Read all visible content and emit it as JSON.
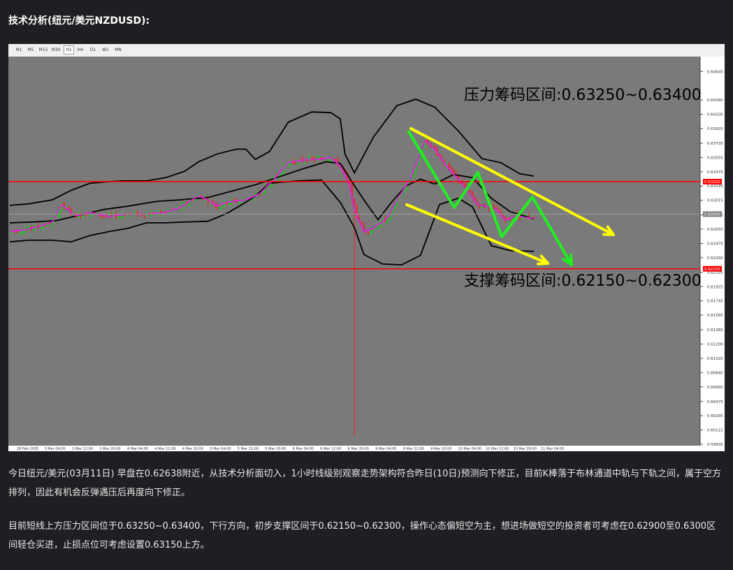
{
  "page_title": "技术分析(纽元/美元NZDUSD):",
  "toolbar": {
    "timeframes": [
      "M1",
      "M5",
      "M15",
      "M30",
      "H1",
      "H4",
      "D1",
      "W1",
      "MN"
    ],
    "active": "H1"
  },
  "colors": {
    "plot_bg": "#7a7a7a",
    "bull": "#00dd00",
    "bear": "#ff1a1a",
    "band": "#000000",
    "ma": "#e020e0",
    "sr_line": "#ff0000",
    "channel": "#ffff00",
    "path": "#22ee22"
  },
  "chart_data": {
    "type": "candlestick",
    "symbol": "NZDUSD",
    "timeframe": "H1",
    "ylim": [
      0.59935,
      0.6474
    ],
    "yticks": [
      "0.64640",
      "0.64280",
      "0.64100",
      "0.63920",
      "0.63735",
      "0.63555",
      "0.63375",
      "0.63195",
      "0.63015",
      "0.62830",
      "0.62650",
      "0.62470",
      "0.62290",
      "0.62105",
      "0.61925",
      "0.61745",
      "0.61565",
      "0.61380",
      "0.61200",
      "0.61020",
      "0.60840",
      "0.60660",
      "0.60475",
      "0.60295",
      "0.60115",
      "0.59935"
    ],
    "xticks": [
      "28 Feb 2025",
      "3 Mar 04:00",
      "3 Mar 12:00",
      "3 Mar 20:00",
      "4 Mar 04:00",
      "4 Mar 12:00",
      "4 Mar 20:00",
      "5 Mar 04:00",
      "5 Mar 12:00",
      "5 Mar 20:00",
      "6 Mar 04:00",
      "6 Mar 12:00",
      "6 Mar 20:00",
      "9 Mar 04:00",
      "9 Mar 12:00",
      "9 Mar 20:00",
      "10 Mar 04:00",
      "10 Mar 12:00",
      "10 Mar 20:00",
      "11 Mar 04:00"
    ],
    "price_labels": [
      {
        "value": 0.6325,
        "text": "0.63250",
        "color": "#ff0000"
      },
      {
        "value": 0.6284,
        "text": "0.62840",
        "color": "#808080"
      },
      {
        "value": 0.6215,
        "text": "0.62150",
        "color": "#ff0000"
      }
    ],
    "resistance_zone": {
      "label": "压力筹码区间:0.63250~0.63400",
      "line": 0.6325
    },
    "support_zone": {
      "label": "支撑筹码区间:0.62150~0.62300",
      "line": 0.6215
    },
    "spike_low": 0.6005,
    "upper_band": [
      [
        0,
        0.6295
      ],
      [
        8,
        0.6297
      ],
      [
        18,
        0.6302
      ],
      [
        26,
        0.6314
      ],
      [
        34,
        0.6323
      ],
      [
        42,
        0.6325
      ],
      [
        48,
        0.6326
      ],
      [
        58,
        0.6326
      ],
      [
        66,
        0.633
      ],
      [
        74,
        0.6338
      ],
      [
        80,
        0.635
      ],
      [
        88,
        0.636
      ],
      [
        96,
        0.6366
      ],
      [
        100,
        0.6366
      ],
      [
        104,
        0.6353
      ],
      [
        110,
        0.6363
      ],
      [
        118,
        0.64
      ],
      [
        128,
        0.6413
      ],
      [
        136,
        0.6412
      ],
      [
        140,
        0.6404
      ],
      [
        142,
        0.636
      ],
      [
        146,
        0.6336
      ],
      [
        154,
        0.6381
      ],
      [
        164,
        0.6421
      ],
      [
        172,
        0.6429
      ],
      [
        180,
        0.6419
      ],
      [
        190,
        0.6389
      ],
      [
        200,
        0.6354
      ],
      [
        208,
        0.6349
      ],
      [
        216,
        0.6335
      ],
      [
        222,
        0.6332
      ]
    ],
    "lower_band": [
      [
        0,
        0.6249
      ],
      [
        8,
        0.6251
      ],
      [
        18,
        0.6251
      ],
      [
        26,
        0.6249
      ],
      [
        34,
        0.6257
      ],
      [
        42,
        0.6262
      ],
      [
        50,
        0.6266
      ],
      [
        58,
        0.6273
      ],
      [
        66,
        0.6273
      ],
      [
        74,
        0.6274
      ],
      [
        84,
        0.6275
      ],
      [
        92,
        0.6285
      ],
      [
        100,
        0.6299
      ],
      [
        104,
        0.6307
      ],
      [
        110,
        0.6323
      ],
      [
        122,
        0.6326
      ],
      [
        132,
        0.6327
      ],
      [
        140,
        0.6299
      ],
      [
        146,
        0.6267
      ],
      [
        150,
        0.6233
      ],
      [
        158,
        0.6221
      ],
      [
        166,
        0.622
      ],
      [
        174,
        0.6232
      ],
      [
        182,
        0.6296
      ],
      [
        190,
        0.6304
      ],
      [
        196,
        0.6293
      ],
      [
        204,
        0.6244
      ],
      [
        212,
        0.6238
      ],
      [
        222,
        0.6237
      ]
    ],
    "mid_band": [
      [
        0,
        0.6273
      ],
      [
        10,
        0.6274
      ],
      [
        20,
        0.6276
      ],
      [
        30,
        0.6283
      ],
      [
        40,
        0.629
      ],
      [
        50,
        0.6294
      ],
      [
        62,
        0.63
      ],
      [
        72,
        0.6302
      ],
      [
        84,
        0.6305
      ],
      [
        94,
        0.6313
      ],
      [
        104,
        0.6321
      ],
      [
        114,
        0.6331
      ],
      [
        124,
        0.6341
      ],
      [
        134,
        0.635
      ],
      [
        140,
        0.6348
      ],
      [
        146,
        0.632
      ],
      [
        150,
        0.6302
      ],
      [
        156,
        0.6277
      ],
      [
        162,
        0.63
      ],
      [
        168,
        0.632
      ],
      [
        174,
        0.6328
      ],
      [
        180,
        0.6322
      ],
      [
        188,
        0.6334
      ],
      [
        196,
        0.633
      ],
      [
        204,
        0.6304
      ],
      [
        212,
        0.6287
      ],
      [
        222,
        0.6278
      ]
    ],
    "ma": [
      [
        0,
        0.6262
      ],
      [
        6,
        0.6264
      ],
      [
        12,
        0.6268
      ],
      [
        18,
        0.6274
      ],
      [
        22,
        0.6296
      ],
      [
        28,
        0.6282
      ],
      [
        34,
        0.6286
      ],
      [
        42,
        0.6281
      ],
      [
        50,
        0.6284
      ],
      [
        58,
        0.6284
      ],
      [
        66,
        0.6286
      ],
      [
        72,
        0.6292
      ],
      [
        76,
        0.63
      ],
      [
        80,
        0.6307
      ],
      [
        84,
        0.6302
      ],
      [
        88,
        0.6294
      ],
      [
        92,
        0.6299
      ],
      [
        100,
        0.6302
      ],
      [
        106,
        0.631
      ],
      [
        112,
        0.6328
      ],
      [
        118,
        0.6349
      ],
      [
        124,
        0.6352
      ],
      [
        130,
        0.6353
      ],
      [
        136,
        0.6355
      ],
      [
        140,
        0.6345
      ],
      [
        144,
        0.632
      ],
      [
        146,
        0.629
      ],
      [
        150,
        0.6262
      ],
      [
        154,
        0.6266
      ],
      [
        160,
        0.6279
      ],
      [
        164,
        0.6302
      ],
      [
        170,
        0.633
      ],
      [
        176,
        0.6377
      ],
      [
        180,
        0.6366
      ],
      [
        186,
        0.6341
      ],
      [
        192,
        0.6321
      ],
      [
        198,
        0.6297
      ],
      [
        206,
        0.629
      ],
      [
        210,
        0.6276
      ],
      [
        214,
        0.6282
      ],
      [
        218,
        0.628
      ],
      [
        222,
        0.6279
      ]
    ]
  },
  "paragraphs": [
    "今日纽元/美元(03月11日) 早盘在0.62638附近，从技术分析面切入，1小时线级别观察走势架构符合昨日(10日)预测向下修正，目前K棒落于布林通道中轨与下轨之间，属于空方排列，因此有机会反弹遇压后再度向下修正。",
    "目前短线上方压力区间位于0.63250~0.63400，下行方向，初步支撑区间于0.62150~0.62300，操作心态偏短空为主，想进场做短空的投资者可考虑在0.62900至0.6300区间轻仓买进，止损点位可考虑设置0.63150上方。"
  ]
}
